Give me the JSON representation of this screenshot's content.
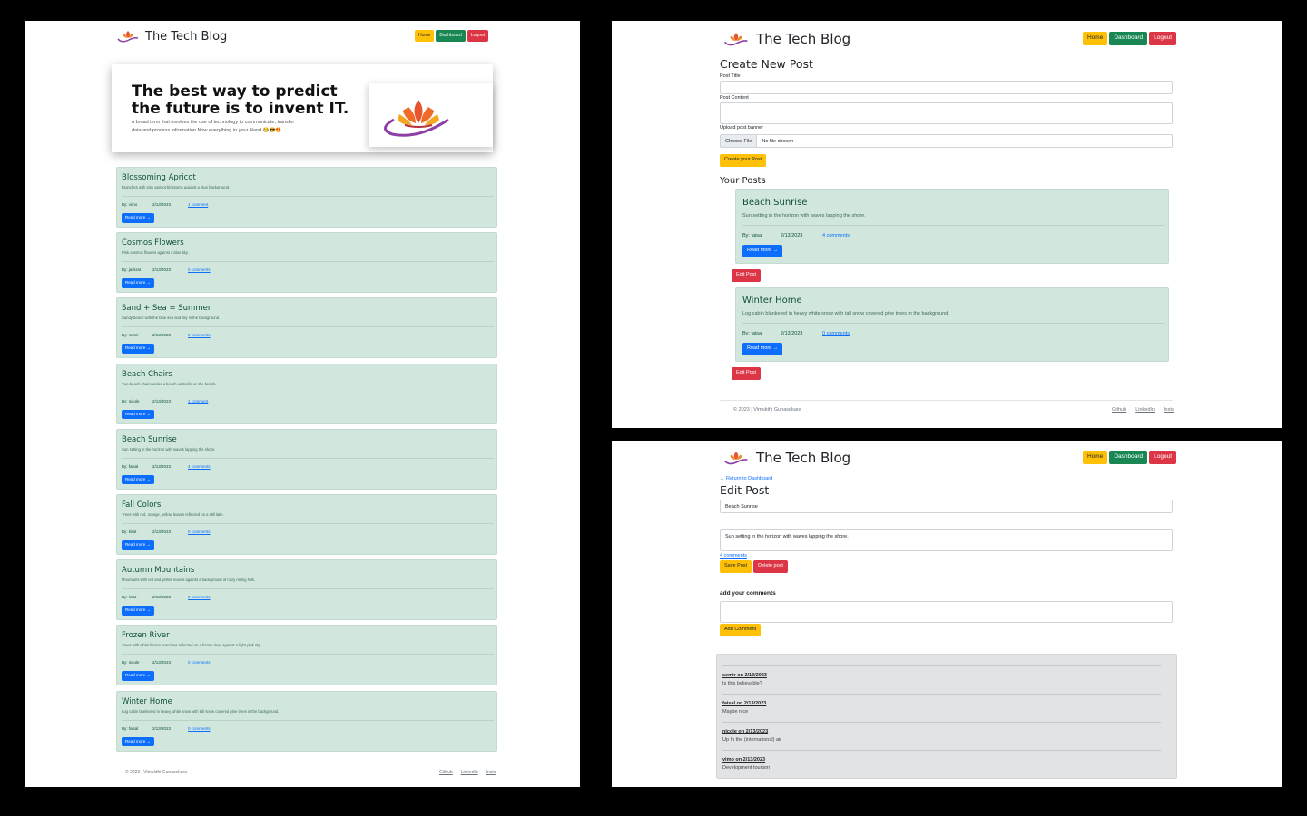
{
  "brand": {
    "title": "The Tech Blog"
  },
  "nav": {
    "home": "Home",
    "dashboard": "Dashboard",
    "logout": "Logout"
  },
  "hero": {
    "heading_line1": "The best way to predict",
    "heading_line2": "the future is to invent IT.",
    "text_line1": "a broad term that involves the use of technology to communicate, transfer",
    "text_line2": "data and process information.Now everything in your Hand.😂😎😍"
  },
  "posts": [
    {
      "title": "Blossoming Apricot",
      "desc": "Branches with pink apricot blossoms against a blue background.",
      "author": "By: vimo",
      "date": "2/13/2023",
      "comments": "1 comment",
      "read_more": "Read more →"
    },
    {
      "title": "Cosmos Flowers",
      "desc": "Pink cosmos flowers against a blue sky.",
      "author": "By: jaskrat",
      "date": "2/13/2023",
      "comments": "0 comments",
      "read_more": "Read more →"
    },
    {
      "title": "Sand + Sea = Summer",
      "desc": "Sandy beach with the blue sea and sky in the background.",
      "author": "By: semir",
      "date": "2/13/2023",
      "comments": "0 comments",
      "read_more": "Read more →"
    },
    {
      "title": "Beach Chairs",
      "desc": "Two beach chairs under a beach umbrella on the beach.",
      "author": "By: nicole",
      "date": "2/13/2023",
      "comments": "1 comment",
      "read_more": "Read more →"
    },
    {
      "title": "Beach Sunrise",
      "desc": "Sun setting in the horizon with waves lapping the shore.",
      "author": "By: faisal",
      "date": "2/13/2023",
      "comments": "4 comments",
      "read_more": "Read more →"
    },
    {
      "title": "Fall Colors",
      "desc": "Trees with red, orange, yellow leaves reflected on a still lake.",
      "author": "By: kirat",
      "date": "2/13/2023",
      "comments": "0 comments",
      "read_more": "Read more →"
    },
    {
      "title": "Autumn Mountains",
      "desc": "Mountains with red and yellow leaves against a background of hazy rolling hills.",
      "author": "By: kirat",
      "date": "2/13/2023",
      "comments": "0 comments",
      "read_more": "Read more →"
    },
    {
      "title": "Frozen River",
      "desc": "Trees with white frozen branches reflected on a frozen river against a light pink sky.",
      "author": "By: nicole",
      "date": "2/13/2023",
      "comments": "0 comments",
      "read_more": "Read more →"
    },
    {
      "title": "Winter Home",
      "desc": "Log cabin blanketed in heavy white snow with tall snow covered pine trees in the background.",
      "author": "By: faisal",
      "date": "2/13/2023",
      "comments": "0 comments",
      "read_more": "Read more →"
    }
  ],
  "footer": {
    "copyright": "© 2023 | Vimukthi Gunasekara",
    "github": "Github",
    "linkedin": "LinkedIn",
    "insta": "Insta"
  },
  "dashboard": {
    "heading": "Create New Post",
    "post_title_label": "Post Title",
    "post_content_label": "Post Content",
    "upload_label": "Upload post banner",
    "choose_file": "Choose File",
    "no_file": "No file chosen",
    "create_button": "Create your Post",
    "your_posts": "Your Posts",
    "edit_button": "Edit Post",
    "posts": [
      {
        "title": "Beach Sunrise",
        "desc": "Sun setting in the horizon with waves lapping the shore.",
        "author": "By: faisal",
        "date": "2/13/2023",
        "comments": "4 comments",
        "read_more": "Read more →"
      },
      {
        "title": "Winter Home",
        "desc": "Log cabin blanketed in heavy white snow with tall snow covered pine trees in the background.",
        "author": "By: faisal",
        "date": "2/13/2023",
        "comments": "0 comments",
        "read_more": "Read more →"
      }
    ]
  },
  "edit": {
    "return_link": "← Return to Dashboard",
    "heading": "Edit Post",
    "title_value": "Beach Sunrise",
    "content_value": "Sun setting in the horizon with waves lapping the shore.",
    "comments_link": "4 comments",
    "save_button": "Save Post",
    "delete_button": "Delete post",
    "add_comments_label": "add your comments",
    "add_comment_button": "Add Comment",
    "comments": [
      {
        "header": "semir on 2/13/2023",
        "text": "Is this believable?"
      },
      {
        "header": "faisal on 2/13/2023",
        "text": "Maybe nice"
      },
      {
        "header": "nicole on 2/13/2023",
        "text": "Up In the (international) air"
      },
      {
        "header": "vimo on 2/13/2023",
        "text": "Development tourism"
      }
    ]
  },
  "colors": {
    "warning": "#ffc107",
    "success": "#198754",
    "danger": "#dc3545",
    "primary": "#0d6efd",
    "card_bg": "#d1e7dd",
    "comment_bg": "#e2e3e5"
  }
}
